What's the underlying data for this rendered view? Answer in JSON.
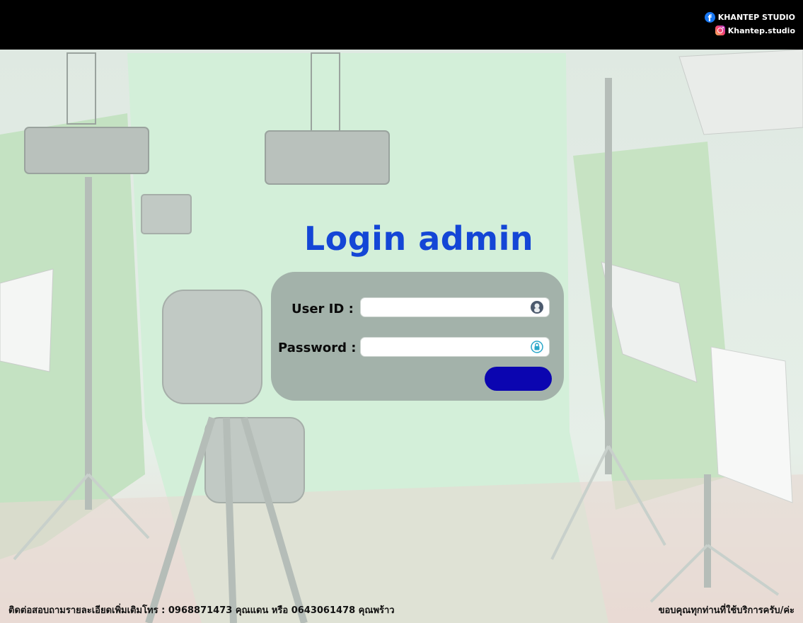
{
  "header": {
    "facebook_label": "KHANTEP STUDIO",
    "instagram_label": "Khantep.studio"
  },
  "login": {
    "title": "Login admin",
    "user_label": "User ID :",
    "user_value": "",
    "password_label": "Password :",
    "password_value": "",
    "submit_label": ""
  },
  "footer": {
    "contact_text": "ติดต่อสอบถามรายละเอียดเพิ่มเติมโทร : 0968871473 คุณแดน หรือ 0643061478 คุณพร้าว",
    "thanks_text": "ขอบคุณทุกท่านที่ใช้บริการครับ/ค่ะ"
  },
  "colors": {
    "topbar": "#000000",
    "title": "#1446d6",
    "panel": "#a3b2aa",
    "submit": "#0b05b0"
  },
  "icons": {
    "user": "user-avatar-icon",
    "password": "lock-icon",
    "facebook": "facebook-icon",
    "instagram": "instagram-icon"
  }
}
